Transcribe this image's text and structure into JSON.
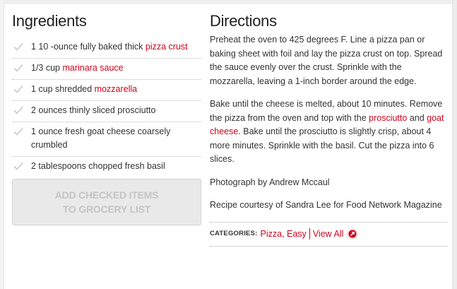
{
  "ingredients": {
    "title": "Ingredients",
    "items": [
      {
        "pre": "1 10 -ounce fully baked thick ",
        "link": "pizza crust",
        "post": ""
      },
      {
        "pre": "1/3 cup ",
        "link": "marinara sauce",
        "post": ""
      },
      {
        "pre": "1 cup shredded ",
        "link": "mozzarella",
        "post": ""
      },
      {
        "pre": "2 ounces thinly sliced prosciutto",
        "link": "",
        "post": ""
      },
      {
        "pre": "1 ounce fresh goat cheese coarsely crumbled",
        "link": "",
        "post": ""
      },
      {
        "pre": "2 tablespoons chopped fresh basil",
        "link": "",
        "post": ""
      }
    ],
    "grocery_button": {
      "line1": "ADD CHECKED ITEMS",
      "line2": "TO GROCERY LIST"
    }
  },
  "directions": {
    "title": "Directions",
    "step1": "Preheat the oven to 425 degrees F. Line a pizza pan or baking sheet with foil and lay the pizza crust on top. Spread the sauce evenly over the crust. Sprinkle with the mozzarella, leaving a 1-inch border around the edge.",
    "step2": {
      "a": "Bake until the cheese is melted, about 10 minutes. Remove the pizza from the oven and top with the ",
      "link1": "prosciutto",
      "b": " and ",
      "link2": "goat cheese",
      "c": ". Bake until the prosciutto is slightly crisp, about 4 more minutes. Sprinkle with the basil. Cut the pizza into 6 slices."
    },
    "photo_credit": "Photograph by Andrew Mccaul",
    "recipe_credit": "Recipe courtesy of Sandra Lee for Food Network Magazine",
    "categories": {
      "label": "CATEGORIES:",
      "items": [
        "Pizza",
        "Easy"
      ],
      "view_all": "View All"
    }
  },
  "colors": {
    "accent": "#d0021b",
    "button_bg": "#e9e9e9",
    "button_text": "#c4c4c4"
  },
  "icons": {
    "checkbox": "check-outline-icon",
    "view_all": "arrow-circle-icon"
  }
}
